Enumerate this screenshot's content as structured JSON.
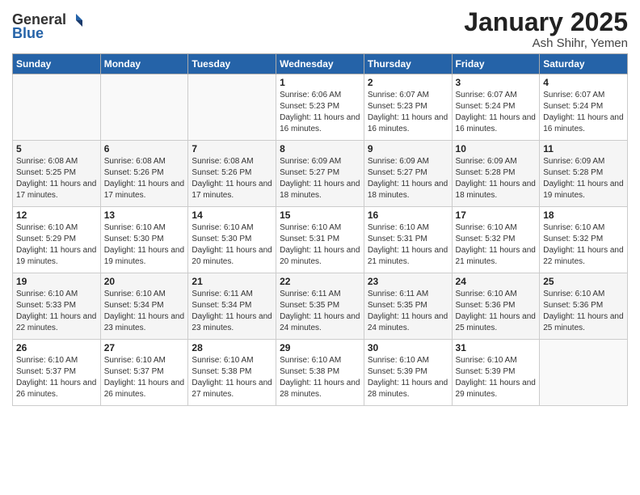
{
  "app": {
    "logo_general": "General",
    "logo_blue": "Blue",
    "month_title": "January 2025",
    "location": "Ash Shihr, Yemen"
  },
  "weekdays": [
    "Sunday",
    "Monday",
    "Tuesday",
    "Wednesday",
    "Thursday",
    "Friday",
    "Saturday"
  ],
  "weeks": [
    [
      {
        "day": "",
        "sunrise": "",
        "sunset": "",
        "daylight": ""
      },
      {
        "day": "",
        "sunrise": "",
        "sunset": "",
        "daylight": ""
      },
      {
        "day": "",
        "sunrise": "",
        "sunset": "",
        "daylight": ""
      },
      {
        "day": "1",
        "sunrise": "Sunrise: 6:06 AM",
        "sunset": "Sunset: 5:23 PM",
        "daylight": "Daylight: 11 hours and 16 minutes."
      },
      {
        "day": "2",
        "sunrise": "Sunrise: 6:07 AM",
        "sunset": "Sunset: 5:23 PM",
        "daylight": "Daylight: 11 hours and 16 minutes."
      },
      {
        "day": "3",
        "sunrise": "Sunrise: 6:07 AM",
        "sunset": "Sunset: 5:24 PM",
        "daylight": "Daylight: 11 hours and 16 minutes."
      },
      {
        "day": "4",
        "sunrise": "Sunrise: 6:07 AM",
        "sunset": "Sunset: 5:24 PM",
        "daylight": "Daylight: 11 hours and 16 minutes."
      }
    ],
    [
      {
        "day": "5",
        "sunrise": "Sunrise: 6:08 AM",
        "sunset": "Sunset: 5:25 PM",
        "daylight": "Daylight: 11 hours and 17 minutes."
      },
      {
        "day": "6",
        "sunrise": "Sunrise: 6:08 AM",
        "sunset": "Sunset: 5:26 PM",
        "daylight": "Daylight: 11 hours and 17 minutes."
      },
      {
        "day": "7",
        "sunrise": "Sunrise: 6:08 AM",
        "sunset": "Sunset: 5:26 PM",
        "daylight": "Daylight: 11 hours and 17 minutes."
      },
      {
        "day": "8",
        "sunrise": "Sunrise: 6:09 AM",
        "sunset": "Sunset: 5:27 PM",
        "daylight": "Daylight: 11 hours and 18 minutes."
      },
      {
        "day": "9",
        "sunrise": "Sunrise: 6:09 AM",
        "sunset": "Sunset: 5:27 PM",
        "daylight": "Daylight: 11 hours and 18 minutes."
      },
      {
        "day": "10",
        "sunrise": "Sunrise: 6:09 AM",
        "sunset": "Sunset: 5:28 PM",
        "daylight": "Daylight: 11 hours and 18 minutes."
      },
      {
        "day": "11",
        "sunrise": "Sunrise: 6:09 AM",
        "sunset": "Sunset: 5:28 PM",
        "daylight": "Daylight: 11 hours and 19 minutes."
      }
    ],
    [
      {
        "day": "12",
        "sunrise": "Sunrise: 6:10 AM",
        "sunset": "Sunset: 5:29 PM",
        "daylight": "Daylight: 11 hours and 19 minutes."
      },
      {
        "day": "13",
        "sunrise": "Sunrise: 6:10 AM",
        "sunset": "Sunset: 5:30 PM",
        "daylight": "Daylight: 11 hours and 19 minutes."
      },
      {
        "day": "14",
        "sunrise": "Sunrise: 6:10 AM",
        "sunset": "Sunset: 5:30 PM",
        "daylight": "Daylight: 11 hours and 20 minutes."
      },
      {
        "day": "15",
        "sunrise": "Sunrise: 6:10 AM",
        "sunset": "Sunset: 5:31 PM",
        "daylight": "Daylight: 11 hours and 20 minutes."
      },
      {
        "day": "16",
        "sunrise": "Sunrise: 6:10 AM",
        "sunset": "Sunset: 5:31 PM",
        "daylight": "Daylight: 11 hours and 21 minutes."
      },
      {
        "day": "17",
        "sunrise": "Sunrise: 6:10 AM",
        "sunset": "Sunset: 5:32 PM",
        "daylight": "Daylight: 11 hours and 21 minutes."
      },
      {
        "day": "18",
        "sunrise": "Sunrise: 6:10 AM",
        "sunset": "Sunset: 5:32 PM",
        "daylight": "Daylight: 11 hours and 22 minutes."
      }
    ],
    [
      {
        "day": "19",
        "sunrise": "Sunrise: 6:10 AM",
        "sunset": "Sunset: 5:33 PM",
        "daylight": "Daylight: 11 hours and 22 minutes."
      },
      {
        "day": "20",
        "sunrise": "Sunrise: 6:10 AM",
        "sunset": "Sunset: 5:34 PM",
        "daylight": "Daylight: 11 hours and 23 minutes."
      },
      {
        "day": "21",
        "sunrise": "Sunrise: 6:11 AM",
        "sunset": "Sunset: 5:34 PM",
        "daylight": "Daylight: 11 hours and 23 minutes."
      },
      {
        "day": "22",
        "sunrise": "Sunrise: 6:11 AM",
        "sunset": "Sunset: 5:35 PM",
        "daylight": "Daylight: 11 hours and 24 minutes."
      },
      {
        "day": "23",
        "sunrise": "Sunrise: 6:11 AM",
        "sunset": "Sunset: 5:35 PM",
        "daylight": "Daylight: 11 hours and 24 minutes."
      },
      {
        "day": "24",
        "sunrise": "Sunrise: 6:10 AM",
        "sunset": "Sunset: 5:36 PM",
        "daylight": "Daylight: 11 hours and 25 minutes."
      },
      {
        "day": "25",
        "sunrise": "Sunrise: 6:10 AM",
        "sunset": "Sunset: 5:36 PM",
        "daylight": "Daylight: 11 hours and 25 minutes."
      }
    ],
    [
      {
        "day": "26",
        "sunrise": "Sunrise: 6:10 AM",
        "sunset": "Sunset: 5:37 PM",
        "daylight": "Daylight: 11 hours and 26 minutes."
      },
      {
        "day": "27",
        "sunrise": "Sunrise: 6:10 AM",
        "sunset": "Sunset: 5:37 PM",
        "daylight": "Daylight: 11 hours and 26 minutes."
      },
      {
        "day": "28",
        "sunrise": "Sunrise: 6:10 AM",
        "sunset": "Sunset: 5:38 PM",
        "daylight": "Daylight: 11 hours and 27 minutes."
      },
      {
        "day": "29",
        "sunrise": "Sunrise: 6:10 AM",
        "sunset": "Sunset: 5:38 PM",
        "daylight": "Daylight: 11 hours and 28 minutes."
      },
      {
        "day": "30",
        "sunrise": "Sunrise: 6:10 AM",
        "sunset": "Sunset: 5:39 PM",
        "daylight": "Daylight: 11 hours and 28 minutes."
      },
      {
        "day": "31",
        "sunrise": "Sunrise: 6:10 AM",
        "sunset": "Sunset: 5:39 PM",
        "daylight": "Daylight: 11 hours and 29 minutes."
      },
      {
        "day": "",
        "sunrise": "",
        "sunset": "",
        "daylight": ""
      }
    ]
  ]
}
